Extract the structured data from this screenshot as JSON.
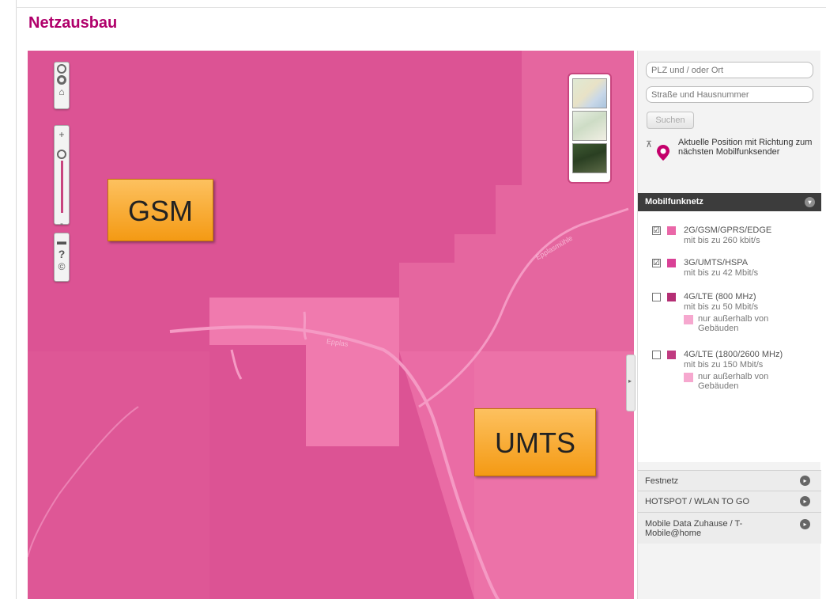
{
  "page": {
    "title": "Netzausbau"
  },
  "map": {
    "labels": {
      "street_epplas": "Epplas",
      "street_epplasmuhle": "Epplasmühle"
    },
    "annotations": {
      "gsm": "GSM",
      "umts": "UMTS"
    },
    "colors": {
      "base": "#e5669f",
      "gsm_dark": "#d94f8e",
      "umts_light": "#f07aae",
      "road": "#f59ac4"
    },
    "controls": {
      "nav": [
        "pan-icon",
        "locate-icon",
        "home-icon"
      ],
      "zoom_in": "+",
      "zoom_out": "-",
      "tools": [
        "print-icon",
        "help-icon",
        "copyright-icon"
      ]
    },
    "layers": [
      "map-layer-icon",
      "terrain-layer-icon",
      "satellite-layer-icon"
    ]
  },
  "panel": {
    "search": {
      "location_placeholder": "PLZ und / oder Ort",
      "street_placeholder": "Straße und Hausnummer",
      "button": "Suchen"
    },
    "position_text": "Aktuelle Position mit Richtung zum nächsten Mobilfunksender",
    "section": {
      "title": "Mobilfunknetz",
      "items": [
        {
          "label": "2G/GSM/GPRS/EDGE",
          "sub": "mit bis zu 260 kbit/s",
          "checked": true,
          "color": "#ea67a8"
        },
        {
          "label": "3G/UMTS/HSPA",
          "sub": "mit bis zu 42 Mbit/s",
          "checked": true,
          "color": "#d94196"
        },
        {
          "label": "4G/LTE (800 MHz)",
          "sub": "mit bis zu 50 Mbit/s",
          "checked": false,
          "color": "#b42e74",
          "note": "nur außerhalb von Gebäuden"
        },
        {
          "label": "4G/LTE (1800/2600 MHz)",
          "sub": "mit bis zu 150 Mbit/s",
          "checked": false,
          "color": "#c03a80",
          "note": "nur außerhalb von Gebäuden"
        }
      ],
      "check_mark": "☑"
    },
    "accordion": [
      {
        "label": "Festnetz"
      },
      {
        "label": "HOTSPOT / WLAN TO GO"
      },
      {
        "label": "Mobile Data Zuhause / T-Mobile@home"
      }
    ]
  }
}
